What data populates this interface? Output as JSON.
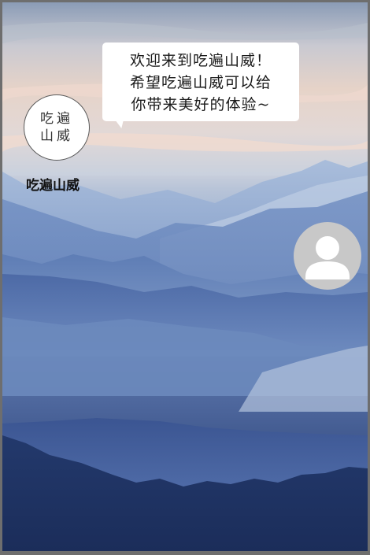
{
  "logo": {
    "text": "吃遍山威"
  },
  "app": {
    "name": "吃遍山威"
  },
  "welcome": {
    "message": "欢迎来到吃遍山威！\n希望吃遍山威可以给\n你带来美好的体验~"
  },
  "avatar": {
    "icon": "user-icon"
  },
  "colors": {
    "bubble": "#ffffff",
    "avatar_bg": "#c8c8c8",
    "mountain_dark": "#1f3262"
  }
}
